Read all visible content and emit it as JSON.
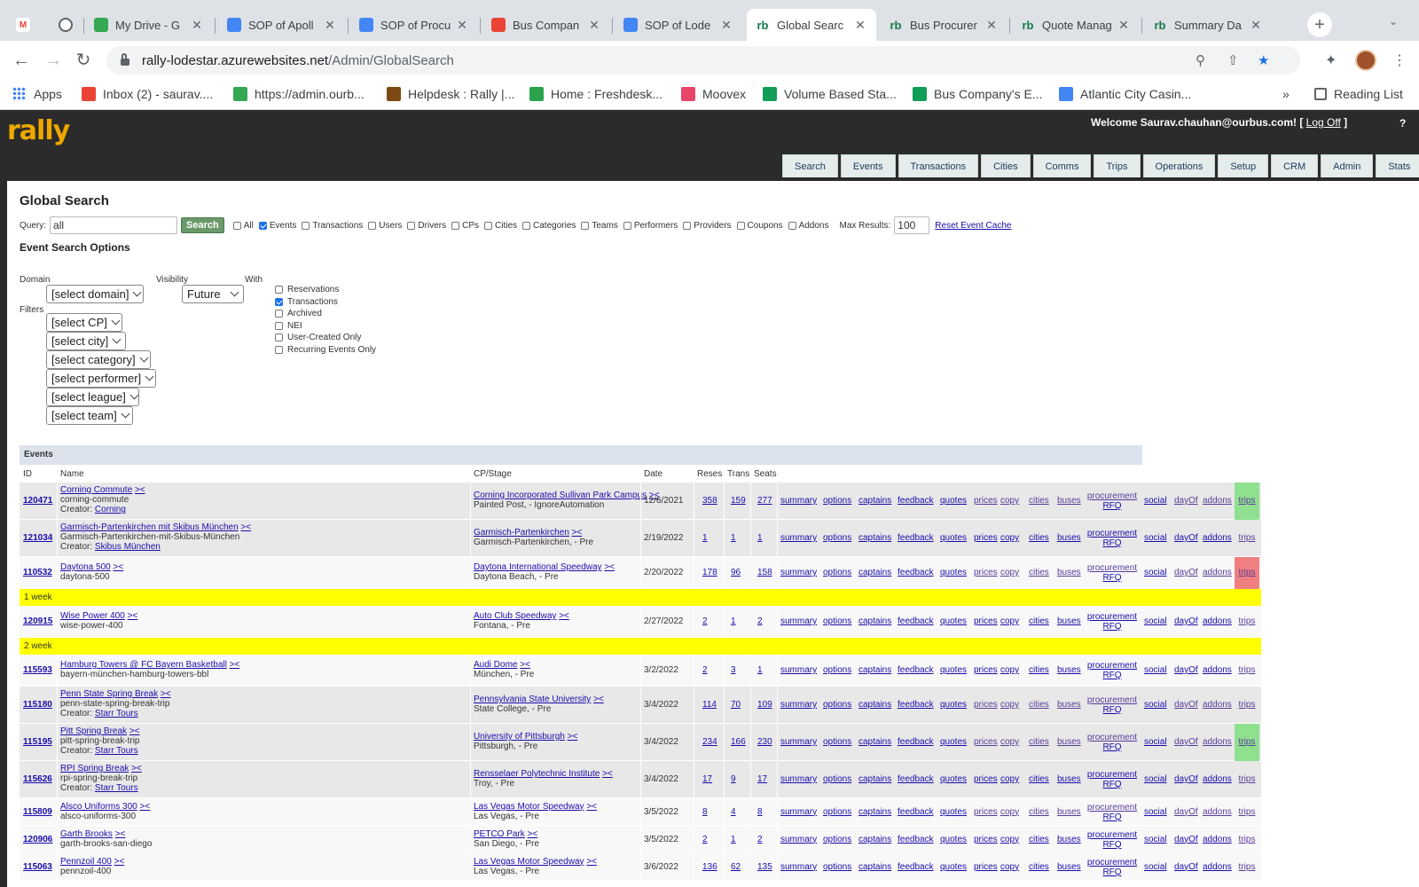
{
  "tabs": [
    {
      "label": "",
      "icon": "gmail-icon"
    },
    {
      "label": "",
      "icon": "globe-icon"
    },
    {
      "label": "My Drive - G",
      "icon": "drive-icon"
    },
    {
      "label": "SOP of Apoll",
      "icon": "docs-icon"
    },
    {
      "label": "SOP of Procu",
      "icon": "docs-icon"
    },
    {
      "label": "Bus Compan",
      "icon": "maps-icon"
    },
    {
      "label": "SOP of Lode",
      "icon": "docs-icon"
    },
    {
      "label": "Global Searc",
      "icon": "rb-icon",
      "active": true
    },
    {
      "label": "Bus Procurer",
      "icon": "rb-icon"
    },
    {
      "label": "Quote Manag",
      "icon": "rb-icon"
    },
    {
      "label": "Summary Da",
      "icon": "rb-icon"
    }
  ],
  "url": {
    "host": "rally-lodestar.azurewebsites.net",
    "path": "/Admin/GlobalSearch"
  },
  "bookmarks": [
    {
      "label": "Apps"
    },
    {
      "label": "Inbox (2) - saurav...."
    },
    {
      "label": "https://admin.ourb..."
    },
    {
      "label": "Helpdesk : Rally |..."
    },
    {
      "label": "Home : Freshdesk..."
    },
    {
      "label": "Moovex"
    },
    {
      "label": "Volume Based Sta..."
    },
    {
      "label": "Bus Company's E..."
    },
    {
      "label": "Atlantic City Casin..."
    }
  ],
  "bookmarks_more": "»",
  "reading_list": "Reading List",
  "header": {
    "logo": "rally",
    "welcome": "Welcome Saurav.chauhan@ourbus.com! [",
    "logoff": "Log Off",
    "welcome_end": "]",
    "help": "?"
  },
  "nav": [
    "Search",
    "Events",
    "Transactions",
    "Cities",
    "Comms",
    "Trips",
    "Operations",
    "Setup",
    "CRM",
    "Admin",
    "Stats"
  ],
  "page_title": "Global Search",
  "query": {
    "label": "Query:",
    "value": "all",
    "button": "Search",
    "checkboxes": [
      {
        "label": "All",
        "checked": false
      },
      {
        "label": "Events",
        "checked": true
      },
      {
        "label": "Transactions",
        "checked": false
      },
      {
        "label": "Users",
        "checked": false
      },
      {
        "label": "Drivers",
        "checked": false
      },
      {
        "label": "CPs",
        "checked": false
      },
      {
        "label": "Cities",
        "checked": false
      },
      {
        "label": "Categories",
        "checked": false
      },
      {
        "label": "Teams",
        "checked": false
      },
      {
        "label": "Performers",
        "checked": false
      },
      {
        "label": "Providers",
        "checked": false
      },
      {
        "label": "Coupons",
        "checked": false
      },
      {
        "label": "Addons",
        "checked": false
      }
    ],
    "max_label": "Max Results:",
    "max_value": "100",
    "reset": "Reset Event Cache"
  },
  "options": {
    "title": "Event Search Options",
    "domain_label": "Domain",
    "visibility_label": "Visibility",
    "with_label": "With",
    "filters_label": "Filters",
    "domain_select": "[select domain]",
    "visibility_select": "Future",
    "filters": [
      "[select CP]",
      "[select city]",
      "[select category]",
      "[select performer]",
      "[select league]",
      "[select team]"
    ],
    "with": [
      {
        "label": "Reservations",
        "checked": false
      },
      {
        "label": "Transactions",
        "checked": true
      },
      {
        "label": "Archived",
        "checked": false
      },
      {
        "label": "NEI",
        "checked": false
      },
      {
        "label": "User-Created Only",
        "checked": false
      },
      {
        "label": "Recurring Events Only",
        "checked": false
      }
    ]
  },
  "events": {
    "title": "Events",
    "columns": [
      "ID",
      "Name",
      "CP/Stage",
      "Date",
      "Reses",
      "Trans",
      "Seats"
    ],
    "actions": [
      "summary",
      "options",
      "captains",
      "feedback",
      "quotes",
      "prices",
      "copy",
      "cities",
      "buses"
    ],
    "procurement": [
      "procurement",
      "RFQ"
    ],
    "actions2": [
      "social",
      "dayOf",
      "addons",
      "trips"
    ],
    "rows": [
      {
        "id": "120471",
        "name": "Corning Commute",
        "slug": "corning-commute",
        "creator": "Corning",
        "cp": "Corning Incorporated Sullivan Park Campus",
        "loc": "Painted Post, - IgnoreAutomation",
        "date": "12/6/2021",
        "reses": "358",
        "trans": "159",
        "seats": "277",
        "trip": "green",
        "blueactions": false,
        "bg": "even"
      },
      {
        "id": "121034",
        "name": "Garmisch-Partenkirchen mit Skibus München",
        "slug": "Garmisch-Partenkirchen-mit-Skibus-München",
        "creator": "Skibus München",
        "cp": "Garmisch-Partenkirchen",
        "loc": "Garmisch-Partenkirchen, - Pre",
        "date": "2/19/2022",
        "reses": "1",
        "trans": "1",
        "seats": "1",
        "trip": "",
        "blueactions": true,
        "bg": "even"
      },
      {
        "id": "110532",
        "name": "Daytona 500",
        "slug": "daytona-500",
        "creator": "",
        "cp": "Daytona International Speedway",
        "loc": "Daytona Beach, - Pre",
        "date": "2/20/2022",
        "reses": "178",
        "trans": "96",
        "seats": "158",
        "trip": "red",
        "blueactions": false,
        "bg": "odd"
      },
      {
        "sep": "1 week"
      },
      {
        "id": "120915",
        "name": "Wise Power 400",
        "slug": "wise-power-400",
        "creator": "",
        "cp": "Auto Club Speedway",
        "loc": "Fontana, - Pre",
        "date": "2/27/2022",
        "reses": "2",
        "trans": "1",
        "seats": "2",
        "trip": "",
        "blueactions": true,
        "bg": "odd"
      },
      {
        "sep": "2 week"
      },
      {
        "id": "115593",
        "name": "Hamburg Towers @ FC Bayern Basketball",
        "slug": "bayern-münchen-hamburg-towers-bbl",
        "creator": "",
        "cp": "Audi Dome",
        "loc": "München, - Pre",
        "date": "3/2/2022",
        "reses": "2",
        "trans": "3",
        "seats": "1",
        "trip": "",
        "blueactions": true,
        "bg": "odd"
      },
      {
        "id": "115180",
        "name": "Penn State Spring Break",
        "slug": "penn-state-spring-break-trip",
        "creator": "Starr Tours",
        "cp": "Pennsylvania State University",
        "loc": "State College, - Pre",
        "date": "3/4/2022",
        "reses": "114",
        "trans": "70",
        "seats": "109",
        "trip": "",
        "blueactions": false,
        "bg": "even"
      },
      {
        "id": "115195",
        "name": "Pitt Spring Break",
        "slug": "pitt-spring-break-trip",
        "creator": "Starr Tours",
        "cp": "University of Pittsburgh",
        "loc": "Pittsburgh, - Pre",
        "date": "3/4/2022",
        "reses": "234",
        "trans": "166",
        "seats": "230",
        "trip": "green",
        "blueactions": false,
        "bg": "even"
      },
      {
        "id": "115626",
        "name": "RPI Spring Break",
        "slug": "rpi-spring-break-trip",
        "creator": "Starr Tours",
        "cp": "Rensselaer Polytechnic Institute",
        "loc": "Troy, - Pre",
        "date": "3/4/2022",
        "reses": "17",
        "trans": "9",
        "seats": "17",
        "trip": "",
        "blueactions": true,
        "bg": "even"
      },
      {
        "id": "115809",
        "name": "Alsco Uniforms 300",
        "slug": "alsco-uniforms-300",
        "creator": "",
        "cp": "Las Vegas Motor Speedway",
        "loc": "Las Vegas, - Pre",
        "date": "3/5/2022",
        "reses": "8",
        "trans": "4",
        "seats": "8",
        "trip": "",
        "blueactions": false,
        "bg": "odd"
      },
      {
        "id": "120906",
        "name": "Garth Brooks",
        "slug": "garth-brooks-san-diego",
        "creator": "",
        "cp": "PETCO Park",
        "loc": "San Diego, - Pre",
        "date": "3/5/2022",
        "reses": "2",
        "trans": "1",
        "seats": "2",
        "trip": "",
        "blueactions": true,
        "bg": "odd"
      },
      {
        "id": "115063",
        "name": "Pennzoil 400",
        "slug": "pennzoil-400",
        "creator": "",
        "cp": "Las Vegas Motor Speedway",
        "loc": "Las Vegas, - Pre",
        "date": "3/6/2022",
        "reses": "136",
        "trans": "62",
        "seats": "135",
        "trip": "",
        "blueactions": true,
        "bg": "odd"
      }
    ],
    "creator_prefix": "Creator:",
    "edit_glyph": "><"
  },
  "colors": {
    "trip_green": "#8fe08f",
    "trip_red": "#f08080",
    "separator": "#ffff00",
    "logo": "#f0a800"
  }
}
